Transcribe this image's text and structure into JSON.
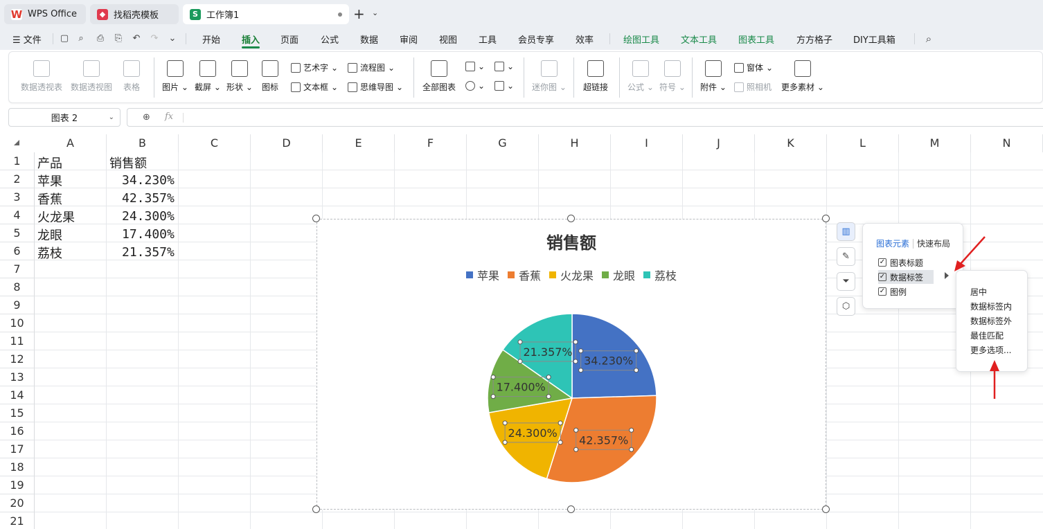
{
  "titlebar": {
    "tabs": [
      {
        "label": "WPS Office",
        "icon": "wps-logo-icon",
        "color": "#e03a2f"
      },
      {
        "label": "找稻壳模板",
        "icon": "docer-logo-icon",
        "color": "#e03a4e"
      },
      {
        "label": "工作簿1",
        "icon": "sheet-logo-icon",
        "color": "#1a9a5c",
        "glyph": "S"
      }
    ]
  },
  "menubar": {
    "file": "文件",
    "items": [
      "开始",
      "插入",
      "页面",
      "公式",
      "数据",
      "审阅",
      "视图",
      "工具",
      "会员专享",
      "效率"
    ],
    "context_items": [
      "绘图工具",
      "文本工具",
      "图表工具"
    ],
    "extra_items": [
      "方方格子",
      "DIY工具箱"
    ],
    "active": "插入"
  },
  "ribbon": {
    "group1": [
      "数据透视表",
      "数据透视图",
      "表格"
    ],
    "group2": [
      "图片",
      "截屏",
      "形状",
      "图标"
    ],
    "group2_small": [
      "艺术字",
      "文本框",
      "流程图",
      "思维导图"
    ],
    "group3": [
      "全部图表"
    ],
    "group4": [
      "迷你图"
    ],
    "group5": [
      "超链接"
    ],
    "group6": [
      "公式",
      "符号"
    ],
    "group7": [
      "附件"
    ],
    "group7_small": [
      "窗体",
      "照相机"
    ],
    "group8": [
      "更多素材"
    ]
  },
  "formula": {
    "namebox": "图表 2",
    "fx": "fx"
  },
  "sheet": {
    "columns": [
      "A",
      "B",
      "C",
      "D",
      "E",
      "F",
      "G",
      "H",
      "I",
      "J",
      "K",
      "L",
      "M",
      "N"
    ],
    "rows": [
      "1",
      "2",
      "3",
      "4",
      "5",
      "6",
      "7",
      "8",
      "9",
      "10",
      "11",
      "12",
      "13",
      "14",
      "15",
      "16",
      "17",
      "18",
      "19",
      "20",
      "21"
    ],
    "header_a": "产品",
    "header_b": "销售额",
    "data": [
      {
        "product": "苹果",
        "value": "34.230%"
      },
      {
        "product": "香蕉",
        "value": "42.357%"
      },
      {
        "product": "火龙果",
        "value": "24.300%"
      },
      {
        "product": "龙眼",
        "value": "17.400%"
      },
      {
        "product": "荔枝",
        "value": "21.357%"
      }
    ]
  },
  "chart_data": {
    "type": "pie",
    "title": "销售额",
    "categories": [
      "苹果",
      "香蕉",
      "火龙果",
      "龙眼",
      "荔枝"
    ],
    "values": [
      34.23,
      42.357,
      24.3,
      17.4,
      21.357
    ],
    "labels": [
      "34.230%",
      "42.357%",
      "24.300%",
      "17.400%",
      "21.357%"
    ],
    "colors": [
      "#4472c4",
      "#ed7d31",
      "#f0b400",
      "#70ad47",
      "#2ec4b6"
    ],
    "legend_position": "top"
  },
  "chart_panel": {
    "tab_elements": "图表元素",
    "tab_layout": "快速布局",
    "items": [
      {
        "label": "图表标题",
        "checked": true
      },
      {
        "label": "数据标签",
        "checked": true
      },
      {
        "label": "图例",
        "checked": true
      }
    ]
  },
  "submenu": {
    "items": [
      "居中",
      "数据标签内",
      "数据标签外",
      "最佳匹配",
      "更多选项..."
    ]
  }
}
